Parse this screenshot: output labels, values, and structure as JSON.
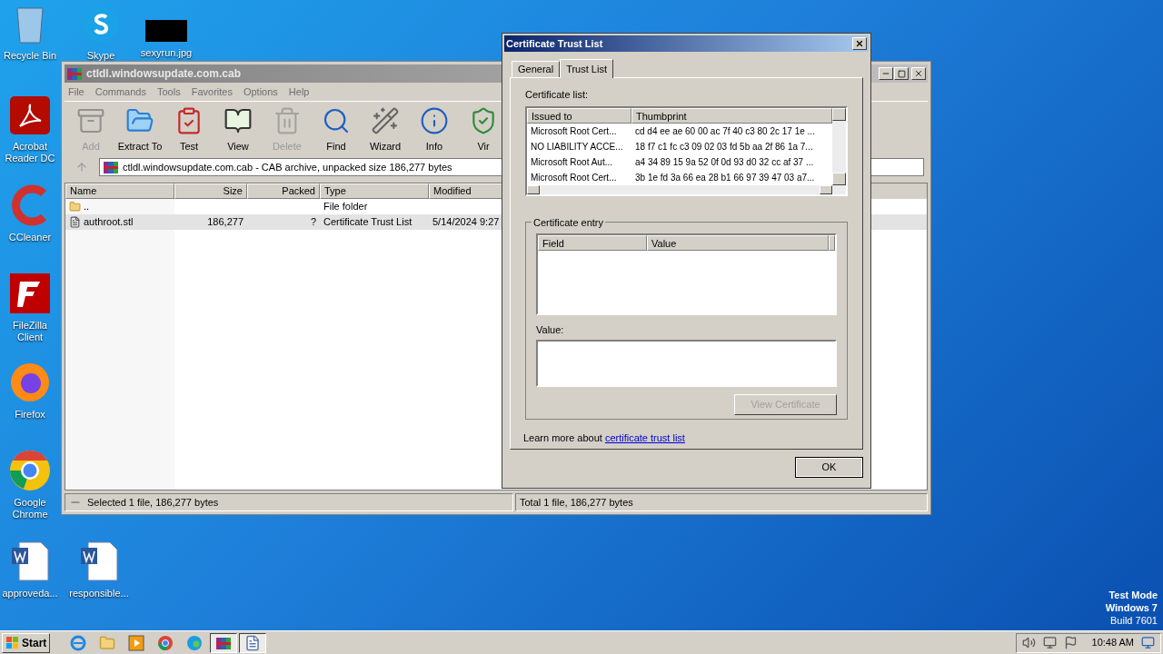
{
  "desktop": {
    "icons": [
      {
        "label": "Recycle Bin",
        "kind": "recycle"
      },
      {
        "label": "Skype",
        "kind": "skype"
      },
      {
        "label": "sexyrun.jpg",
        "kind": "image"
      },
      {
        "label": "Acrobat Reader DC",
        "kind": "acrobat"
      },
      {
        "label": "CCleaner",
        "kind": "ccleaner"
      },
      {
        "label": "FileZilla Client",
        "kind": "filezilla"
      },
      {
        "label": "Firefox",
        "kind": "firefox"
      },
      {
        "label": "Google Chrome",
        "kind": "chrome"
      },
      {
        "label": "approveda...",
        "kind": "word"
      },
      {
        "label": "responsible...",
        "kind": "word"
      }
    ],
    "os_notice": [
      "Test Mode",
      "Windows 7",
      "Build 7601"
    ]
  },
  "archive_window": {
    "title": "ctldl.windowsupdate.com.cab",
    "menu": [
      "File",
      "Commands",
      "Tools",
      "Favorites",
      "Options",
      "Help"
    ],
    "toolbar": [
      {
        "label": "Add",
        "kind": "add",
        "disabled": true
      },
      {
        "label": "Extract To",
        "kind": "extract",
        "disabled": false
      },
      {
        "label": "Test",
        "kind": "test",
        "disabled": false
      },
      {
        "label": "View",
        "kind": "view",
        "disabled": false
      },
      {
        "label": "Delete",
        "kind": "delete",
        "disabled": true
      },
      {
        "label": "Find",
        "kind": "find",
        "disabled": false
      },
      {
        "label": "Wizard",
        "kind": "wizard",
        "disabled": false
      },
      {
        "label": "Info",
        "kind": "info",
        "disabled": false
      },
      {
        "label": "Vir",
        "kind": "virus",
        "disabled": false
      }
    ],
    "address": "ctldl.windowsupdate.com.cab - CAB archive, unpacked size 186,277 bytes",
    "columns": [
      "Name",
      "Size",
      "Packed",
      "Type",
      "Modified"
    ],
    "rows": [
      {
        "kind": "folder",
        "name": "..",
        "size": "",
        "packed": "",
        "type": "File folder",
        "modified": "",
        "selected": false
      },
      {
        "kind": "file",
        "name": "authroot.stl",
        "size": "186,277",
        "packed": "?",
        "type": "Certificate Trust List",
        "modified": "5/14/2024 9:27",
        "selected": true
      }
    ],
    "status": [
      "Selected 1 file, 186,277 bytes",
      "Total 1 file, 186,277 bytes"
    ]
  },
  "dialog": {
    "title": "Certificate Trust List",
    "tabs": [
      {
        "label": "General",
        "selected": false
      },
      {
        "label": "Trust List",
        "selected": true
      }
    ],
    "list_label": "Certificate list:",
    "list_columns": [
      "Issued to",
      "Thumbprint"
    ],
    "list_rows": [
      {
        "issued_to": "Microsoft Root Cert...",
        "thumbprint": "cd d4 ee ae 60 00 ac 7f 40 c3 80 2c 17 1e ..."
      },
      {
        "issued_to": "NO LIABILITY ACCE...",
        "thumbprint": "18 f7 c1 fc c3 09 02 03 fd 5b aa 2f 86 1a 7..."
      },
      {
        "issued_to": "Microsoft Root Aut...",
        "thumbprint": "a4 34 89 15 9a 52 0f 0d 93 d0 32 cc af 37 ..."
      },
      {
        "issued_to": "Microsoft Root Cert...",
        "thumbprint": "3b 1e fd 3a 66 ea 28 b1 66 97 39 47 03 a7..."
      }
    ],
    "entry_label": "Certificate entry",
    "entry_columns": [
      "Field",
      "Value"
    ],
    "value_label": "Value:",
    "view_button": {
      "label": "View Certificate",
      "disabled": true
    },
    "learn_more": "Learn more about",
    "learn_link": "certificate trust list",
    "ok": "OK"
  },
  "taskbar": {
    "start": "Start",
    "apps": [
      {
        "kind": "ie",
        "active": false
      },
      {
        "kind": "explorer",
        "active": false
      },
      {
        "kind": "media",
        "active": false
      },
      {
        "kind": "chrome",
        "active": false
      },
      {
        "kind": "edge",
        "active": false
      },
      {
        "kind": "winrar",
        "active": true
      },
      {
        "kind": "document",
        "active": true
      }
    ],
    "time": "10:48 AM"
  }
}
